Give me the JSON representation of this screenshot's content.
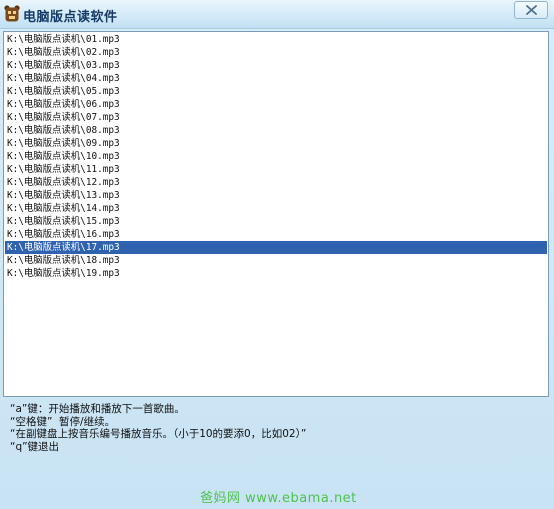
{
  "window": {
    "title": "电脑版点读软件",
    "icon": "bear-app-icon",
    "close_icon": "close-icon"
  },
  "list": {
    "items": [
      "K:\\电脑版点读机\\01.mp3",
      "K:\\电脑版点读机\\02.mp3",
      "K:\\电脑版点读机\\03.mp3",
      "K:\\电脑版点读机\\04.mp3",
      "K:\\电脑版点读机\\05.mp3",
      "K:\\电脑版点读机\\06.mp3",
      "K:\\电脑版点读机\\07.mp3",
      "K:\\电脑版点读机\\08.mp3",
      "K:\\电脑版点读机\\09.mp3",
      "K:\\电脑版点读机\\10.mp3",
      "K:\\电脑版点读机\\11.mp3",
      "K:\\电脑版点读机\\12.mp3",
      "K:\\电脑版点读机\\13.mp3",
      "K:\\电脑版点读机\\14.mp3",
      "K:\\电脑版点读机\\15.mp3",
      "K:\\电脑版点读机\\16.mp3",
      "K:\\电脑版点读机\\17.mp3",
      "K:\\电脑版点读机\\18.mp3",
      "K:\\电脑版点读机\\19.mp3"
    ],
    "selected_index": 16,
    "selection_color": "#2f63b0"
  },
  "instructions": {
    "line1": "“a”键：开始播放和播放下一首歌曲。",
    "line2": "“空格键”  暂停/继续。",
    "line3": "“在副键盘上按音乐编号播放音乐。（小于10的要添0，比如02）”",
    "line4": "“q”键退出"
  },
  "watermark": "爸妈网 www.ebama.net"
}
